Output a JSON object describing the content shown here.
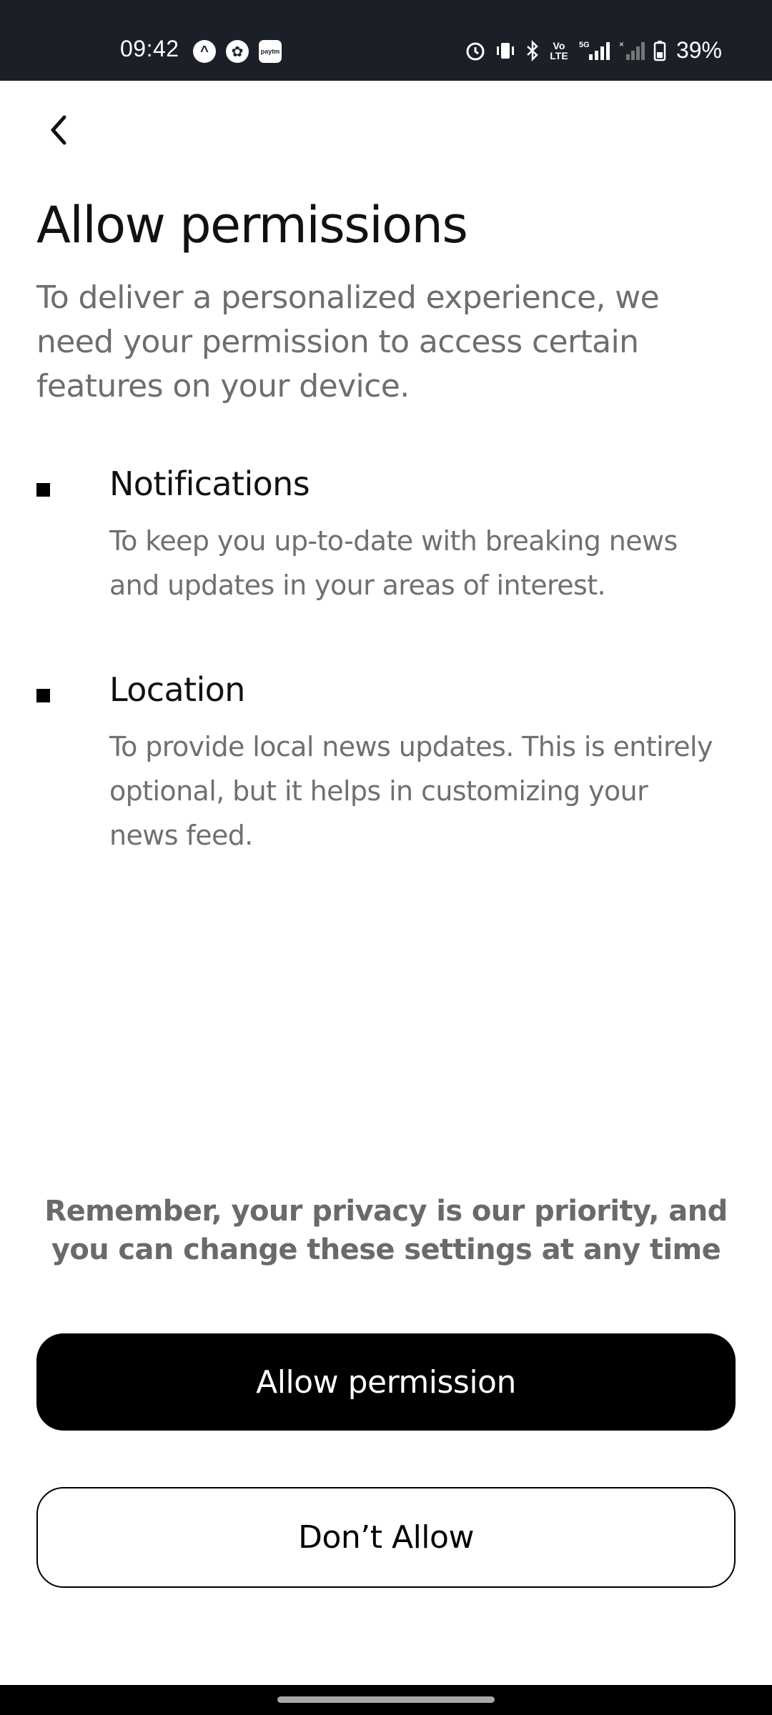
{
  "status_bar": {
    "time": "09:42",
    "battery_percent": "39%",
    "network": "5G",
    "app_icons": [
      "app-a-icon",
      "leaf-app-icon",
      "paytm-icon"
    ],
    "paytm_label": "paytm",
    "volte_label": "Vo LTE"
  },
  "header": {
    "back_icon": "chevron-left-icon"
  },
  "page": {
    "title": "Allow permissions",
    "intro": "To deliver a personalized experience, we need your permission to access certain features on your device."
  },
  "permissions": [
    {
      "title": "Notifications",
      "description": "To keep you up-to-date with breaking news and updates in your areas of interest."
    },
    {
      "title": "Location",
      "description": "To provide local news updates. This is entirely optional, but it helps in customizing your news feed."
    }
  ],
  "privacy_note": "Remember, your privacy is our priority, and you can change these settings at any time",
  "actions": {
    "allow_label": "Allow permission",
    "deny_label": "Don’t Allow"
  },
  "colors": {
    "status_bar_bg": "#1b1f27",
    "primary_button_bg": "#000000",
    "body_text": "#6e6e6e"
  }
}
